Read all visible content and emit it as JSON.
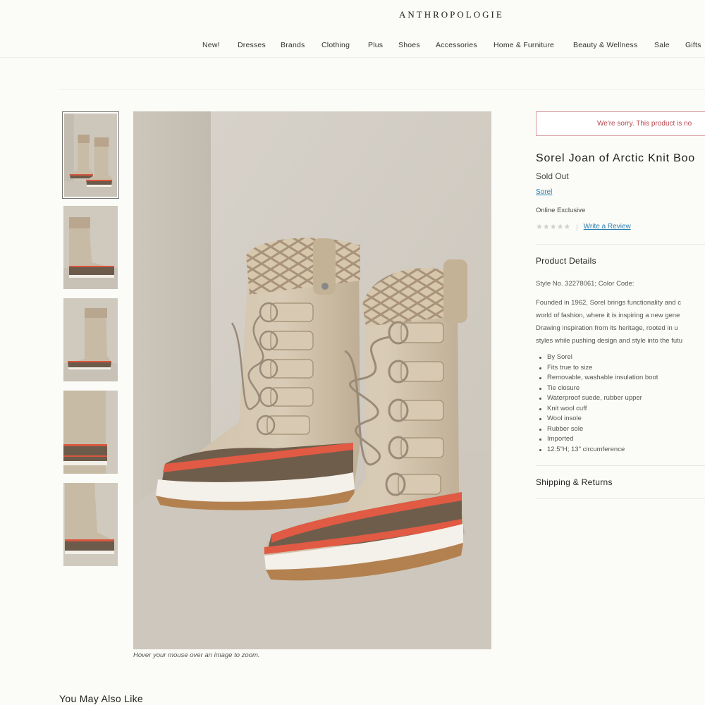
{
  "header": {
    "logo": "ANTHROPOLOGIE",
    "nav": [
      "New!",
      "Dresses",
      "Brands",
      "Clothing",
      "Plus",
      "Shoes",
      "Accessories",
      "Home & Furniture",
      "Beauty & Wellness",
      "Sale",
      "Gifts"
    ]
  },
  "gallery": {
    "thumbnail_count": 5,
    "active_thumbnail": 1,
    "zoom_hint": "Hover your mouse over an image to zoom."
  },
  "product": {
    "unavailable_message": "We're sorry. This product is no",
    "title": "Sorel Joan of Arctic Knit Boo",
    "status": "Sold Out",
    "brand": "Sorel",
    "availability": "Online Exclusive",
    "stars": "★★★★★",
    "rating_separator": "|",
    "write_review": "Write a Review"
  },
  "details": {
    "heading": "Product Details",
    "style_line": "Style No. 32278061; Color Code:",
    "description": [
      "Founded in 1962, Sorel brings functionality and c",
      "world of fashion, where it is inspiring a new gene",
      "Drawing inspiration from its heritage, rooted in u",
      "styles while pushing design and style into the futu"
    ],
    "bullets": [
      "By Sorel",
      "Fits true to size",
      "Removable, washable insulation boot",
      "Tie closure",
      "Waterproof suede, rubber upper",
      "Knit wool cuff",
      "Wool insole",
      "Rubber sole",
      "Imported",
      "12.5\"H; 13\" circumference"
    ]
  },
  "shipping": {
    "heading": "Shipping & Returns"
  },
  "recommendations": {
    "heading": "You May Also Like"
  },
  "colors": {
    "link": "#2d7fb0",
    "alert_text": "#b8474f",
    "alert_border": "#d99aa0",
    "background": "#fbfbf7"
  }
}
